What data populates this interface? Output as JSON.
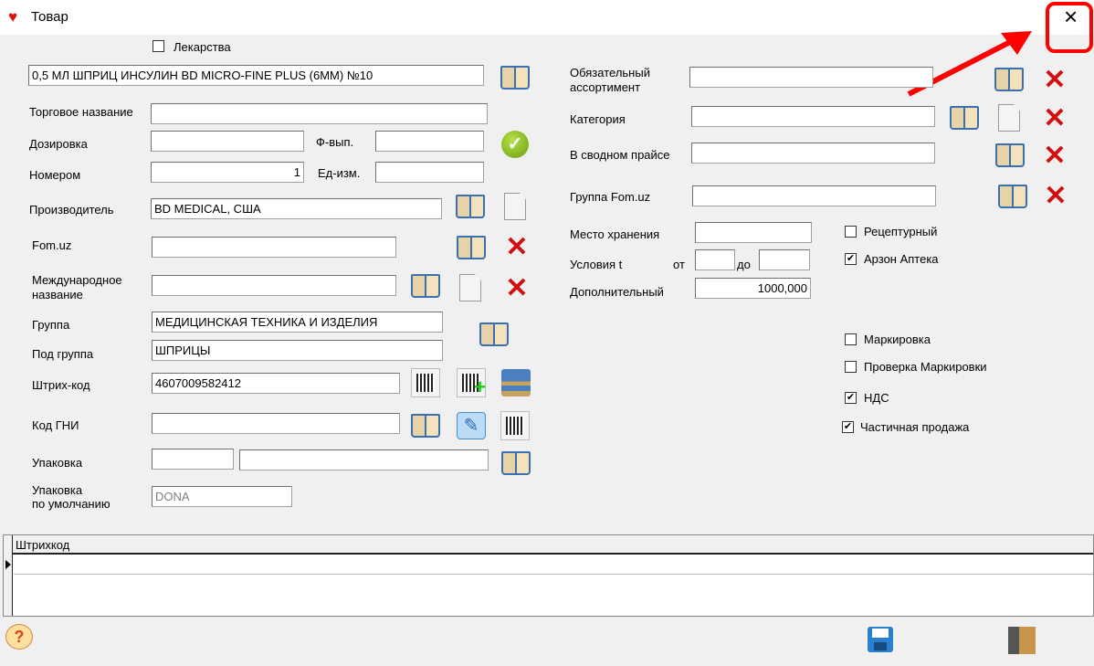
{
  "window": {
    "title": "Товар",
    "close": "×"
  },
  "left": {
    "lekarstva": {
      "label": "Лекарства",
      "checked": false
    },
    "name_value": "0,5 МЛ ШПРИЦ ИНСУЛИН BD MICRO-FINE PLUS (6MM) №10",
    "trade_name": {
      "label": "Торговое название",
      "value": ""
    },
    "dosage": {
      "label": "Дозировка",
      "value": ""
    },
    "form": {
      "label": "Ф-вып.",
      "value": ""
    },
    "number": {
      "label": "Номером",
      "value": "1"
    },
    "unit": {
      "label": "Ед-изм.",
      "value": ""
    },
    "manufacturer": {
      "label": "Производитель",
      "value": "BD MEDICAL, США"
    },
    "fom": {
      "label": "Fom.uz",
      "value": ""
    },
    "intl_name": {
      "label1": "Международное",
      "label2": "название",
      "value": ""
    },
    "group": {
      "label": "Группа",
      "value": "МЕДИЦИНСКАЯ ТЕХНИКА И ИЗДЕЛИЯ"
    },
    "subgroup": {
      "label": "Под группа",
      "value": "ШПРИЦЫ"
    },
    "barcode": {
      "label": "Штрих-код",
      "value": "4607009582412"
    },
    "gni": {
      "label": "Код ГНИ",
      "value": ""
    },
    "pack": {
      "label": "Упаковка",
      "value1": "",
      "value2": ""
    },
    "default_pack": {
      "label1": "Упаковка",
      "label2": "по умолчанию",
      "value": "DONA"
    }
  },
  "right": {
    "mandatory": {
      "label1": "Обязательный",
      "label2": "ассортимент",
      "value": ""
    },
    "category": {
      "label": "Категория",
      "value": ""
    },
    "summary_price": {
      "label": "В сводном прайсе",
      "value": ""
    },
    "fom_group": {
      "label": "Группа Fom.uz",
      "value": ""
    },
    "storage": {
      "label": "Место хранения",
      "value": ""
    },
    "conditions": {
      "label": "Условия t",
      "from": "от",
      "to": "до",
      "from_value": "",
      "to_value": ""
    },
    "additional": {
      "label": "Дополнительный",
      "value": "1000,000"
    },
    "checks": [
      {
        "label": "Рецептурный",
        "checked": false,
        "mark": ""
      },
      {
        "label": "Арзон Аптека",
        "checked": true,
        "mark": "✔"
      },
      {
        "label": "Маркировка",
        "checked": false,
        "mark": ""
      },
      {
        "label": "Проверка Маркировки",
        "checked": false,
        "mark": ""
      },
      {
        "label": "НДС",
        "checked": true,
        "mark": "✔"
      },
      {
        "label": "Частичная продажа",
        "checked": true,
        "mark": "✔"
      }
    ]
  },
  "grid": {
    "column": "Штрихкод"
  },
  "colors": {
    "annotation": "#ff0000",
    "bg": "#f0f0f0"
  }
}
